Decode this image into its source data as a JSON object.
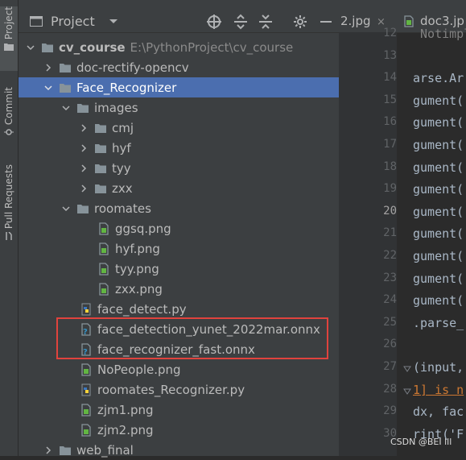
{
  "tool_strip": {
    "tabs": [
      {
        "label": "Project"
      },
      {
        "label": "Commit"
      },
      {
        "label": "Pull Requests"
      }
    ]
  },
  "project_panel": {
    "title": "Project",
    "toolbar_icons": [
      "locate-icon",
      "expand-all-icon",
      "collapse-all-icon",
      "gear-icon",
      "minimize-icon"
    ],
    "tree": [
      {
        "label": "cv_course",
        "path": "E:\\PythonProject\\cv_course",
        "type": "folder",
        "expanded": true
      },
      {
        "label": "doc-rectify-opencv",
        "type": "folder",
        "expanded": false
      },
      {
        "label": "Face_Recognizer",
        "type": "folder",
        "expanded": true,
        "selected": true
      },
      {
        "label": "images",
        "type": "folder",
        "expanded": true
      },
      {
        "label": "cmj",
        "type": "folder",
        "expanded": false
      },
      {
        "label": "hyf",
        "type": "folder",
        "expanded": false
      },
      {
        "label": "tyy",
        "type": "folder",
        "expanded": false
      },
      {
        "label": "zxx",
        "type": "folder",
        "expanded": false
      },
      {
        "label": "roomates",
        "type": "folder",
        "expanded": true
      },
      {
        "label": "ggsq.png",
        "type": "image"
      },
      {
        "label": "hyf.png",
        "type": "image"
      },
      {
        "label": "tyy.png",
        "type": "image"
      },
      {
        "label": "zxx.png",
        "type": "image"
      },
      {
        "label": "face_detect.py",
        "type": "python"
      },
      {
        "label": "face_detection_yunet_2022mar.onnx",
        "type": "unknown"
      },
      {
        "label": "face_recognizer_fast.onnx",
        "type": "unknown"
      },
      {
        "label": "NoPeople.png",
        "type": "image"
      },
      {
        "label": "roomates_Recognizer.py",
        "type": "python"
      },
      {
        "label": "zjm1.png",
        "type": "image"
      },
      {
        "label": "zjm2.png",
        "type": "image"
      },
      {
        "label": "web_final",
        "type": "folder",
        "expanded": false
      }
    ]
  },
  "editor": {
    "tabs": [
      {
        "label": "2.jpg",
        "close": "×"
      },
      {
        "label": "doc3.jp"
      }
    ],
    "line_numbers": [
      "12",
      "13",
      "14",
      "15",
      "16",
      "17",
      "18",
      "19",
      "20",
      "21",
      "22",
      "23",
      "24",
      "25",
      "26",
      "27",
      "28",
      "29",
      "30"
    ],
    "current_line": "20",
    "code_lines": [
      " Notimpl",
      "",
      "arse.Ar",
      "gument(",
      "gument(",
      "gument(",
      "gument(",
      "gument(",
      "gument(",
      "gument(",
      "gument(",
      "gument(",
      "gument(",
      ".parse_",
      "",
      "(input,",
      "1] is n",
      "dx, fac",
      "rint('F"
    ]
  },
  "watermark": "CSDN @BEI lll",
  "colors": {
    "selection": "#4b6eaf",
    "highlight_box": "#e0433d",
    "folder": "#87939a",
    "python_blue": "#3b78c2",
    "python_yellow": "#ffd43b"
  }
}
